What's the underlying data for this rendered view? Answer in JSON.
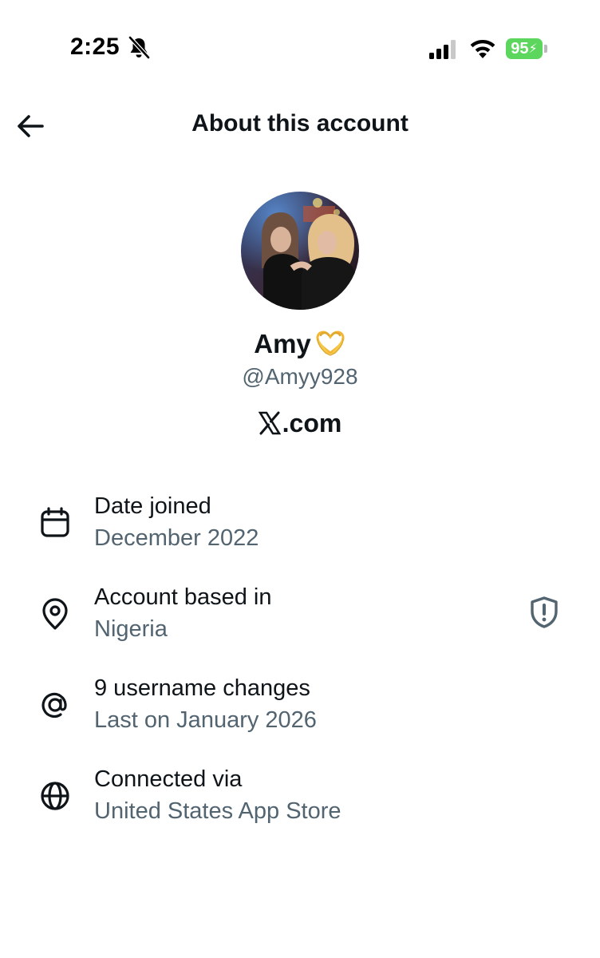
{
  "status_bar": {
    "time": "2:25",
    "battery_level": "95",
    "icons": [
      "bell-slash-icon",
      "cellular-signal-icon",
      "wifi-icon",
      "battery-charging-icon"
    ],
    "battery_color": "#5cd65c"
  },
  "header": {
    "title": "About this account",
    "back_icon": "arrow-left-icon"
  },
  "profile": {
    "display_name": "Amy",
    "name_emoji": "heart-hands-icon",
    "username": "@Amyy928",
    "site": ".com",
    "site_logo": "x-logo-icon"
  },
  "details": [
    {
      "icon": "calendar-icon",
      "label": "Date joined",
      "value": "December 2022"
    },
    {
      "icon": "location-pin-icon",
      "label": "Account based in",
      "value": "Nigeria",
      "badge_icon": "shield-alert-icon"
    },
    {
      "icon": "at-sign-icon",
      "label": "9 username changes",
      "value": "Last on January 2026"
    },
    {
      "icon": "globe-icon",
      "label": "Connected via",
      "value": "United States App Store"
    }
  ],
  "colors": {
    "primary_text": "#0f1419",
    "secondary_text": "#536471",
    "background": "#ffffff"
  }
}
